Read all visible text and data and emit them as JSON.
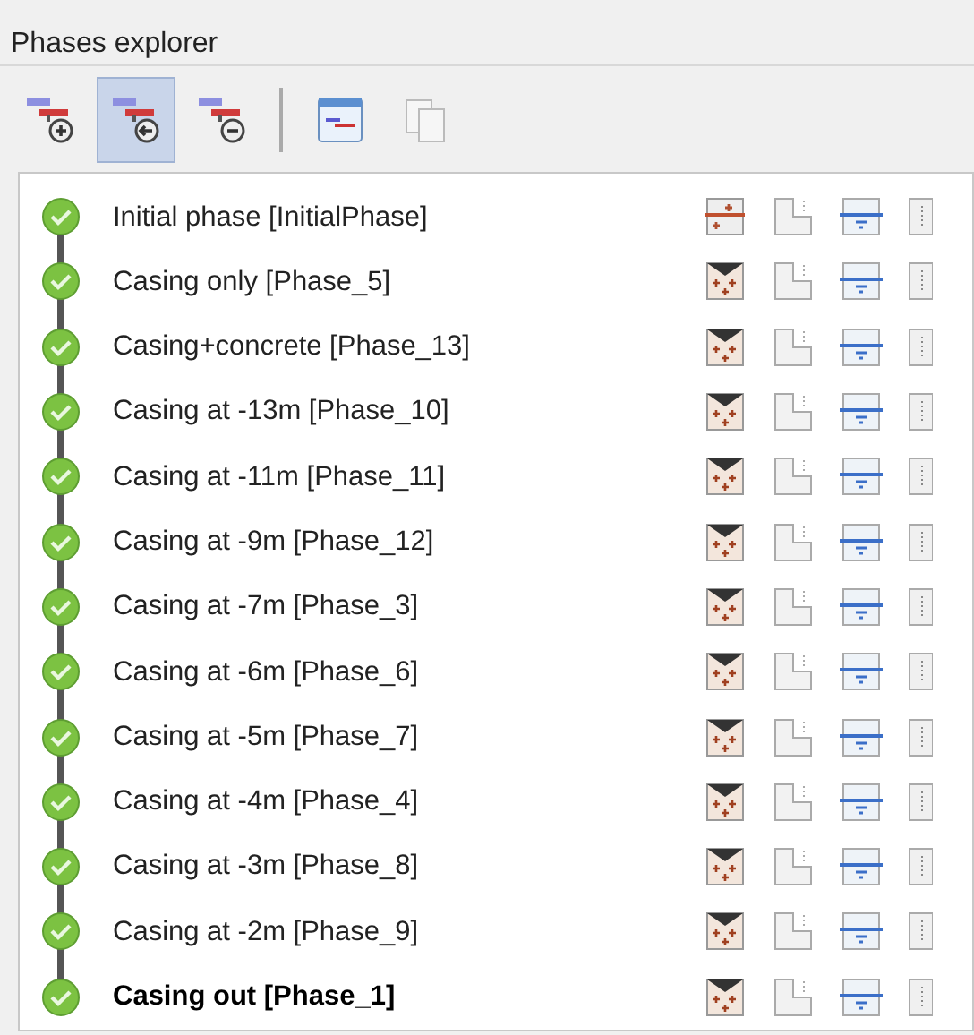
{
  "panel": {
    "title": "Phases explorer"
  },
  "toolbar": [
    {
      "buttons": [
        {
          "kind": "add",
          "pressed": false
        },
        {
          "kind": "insert",
          "pressed": true
        },
        {
          "kind": "delete",
          "pressed": false
        }
      ]
    },
    {
      "buttons": [
        {
          "kind": "window",
          "pressed": false
        },
        {
          "kind": "copy",
          "pressed": false
        }
      ]
    }
  ],
  "phases": [
    {
      "label": "Initial phase [InitialPhase]",
      "kind": "initial",
      "selected": false
    },
    {
      "label": "Casing only [Phase_5]",
      "kind": "phase",
      "selected": false
    },
    {
      "label": "Casing+concrete [Phase_13]",
      "kind": "phase",
      "selected": false
    },
    {
      "label": "Casing at -13m [Phase_10]",
      "kind": "phase",
      "selected": false
    },
    {
      "label": "Casing at -11m [Phase_11]",
      "kind": "phase",
      "selected": false
    },
    {
      "label": "Casing at -9m [Phase_12]",
      "kind": "phase",
      "selected": false
    },
    {
      "label": "Casing at -7m [Phase_3]",
      "kind": "phase",
      "selected": false
    },
    {
      "label": "Casing at -6m [Phase_6]",
      "kind": "phase",
      "selected": false
    },
    {
      "label": "Casing at -5m [Phase_7]",
      "kind": "phase",
      "selected": false
    },
    {
      "label": "Casing at -4m [Phase_4]",
      "kind": "phase",
      "selected": false
    },
    {
      "label": "Casing at -3m [Phase_8]",
      "kind": "phase",
      "selected": false
    },
    {
      "label": "Casing at -2m [Phase_9]",
      "kind": "phase",
      "selected": false
    },
    {
      "label": "Casing out [Phase_1]",
      "kind": "phase",
      "selected": true
    }
  ]
}
